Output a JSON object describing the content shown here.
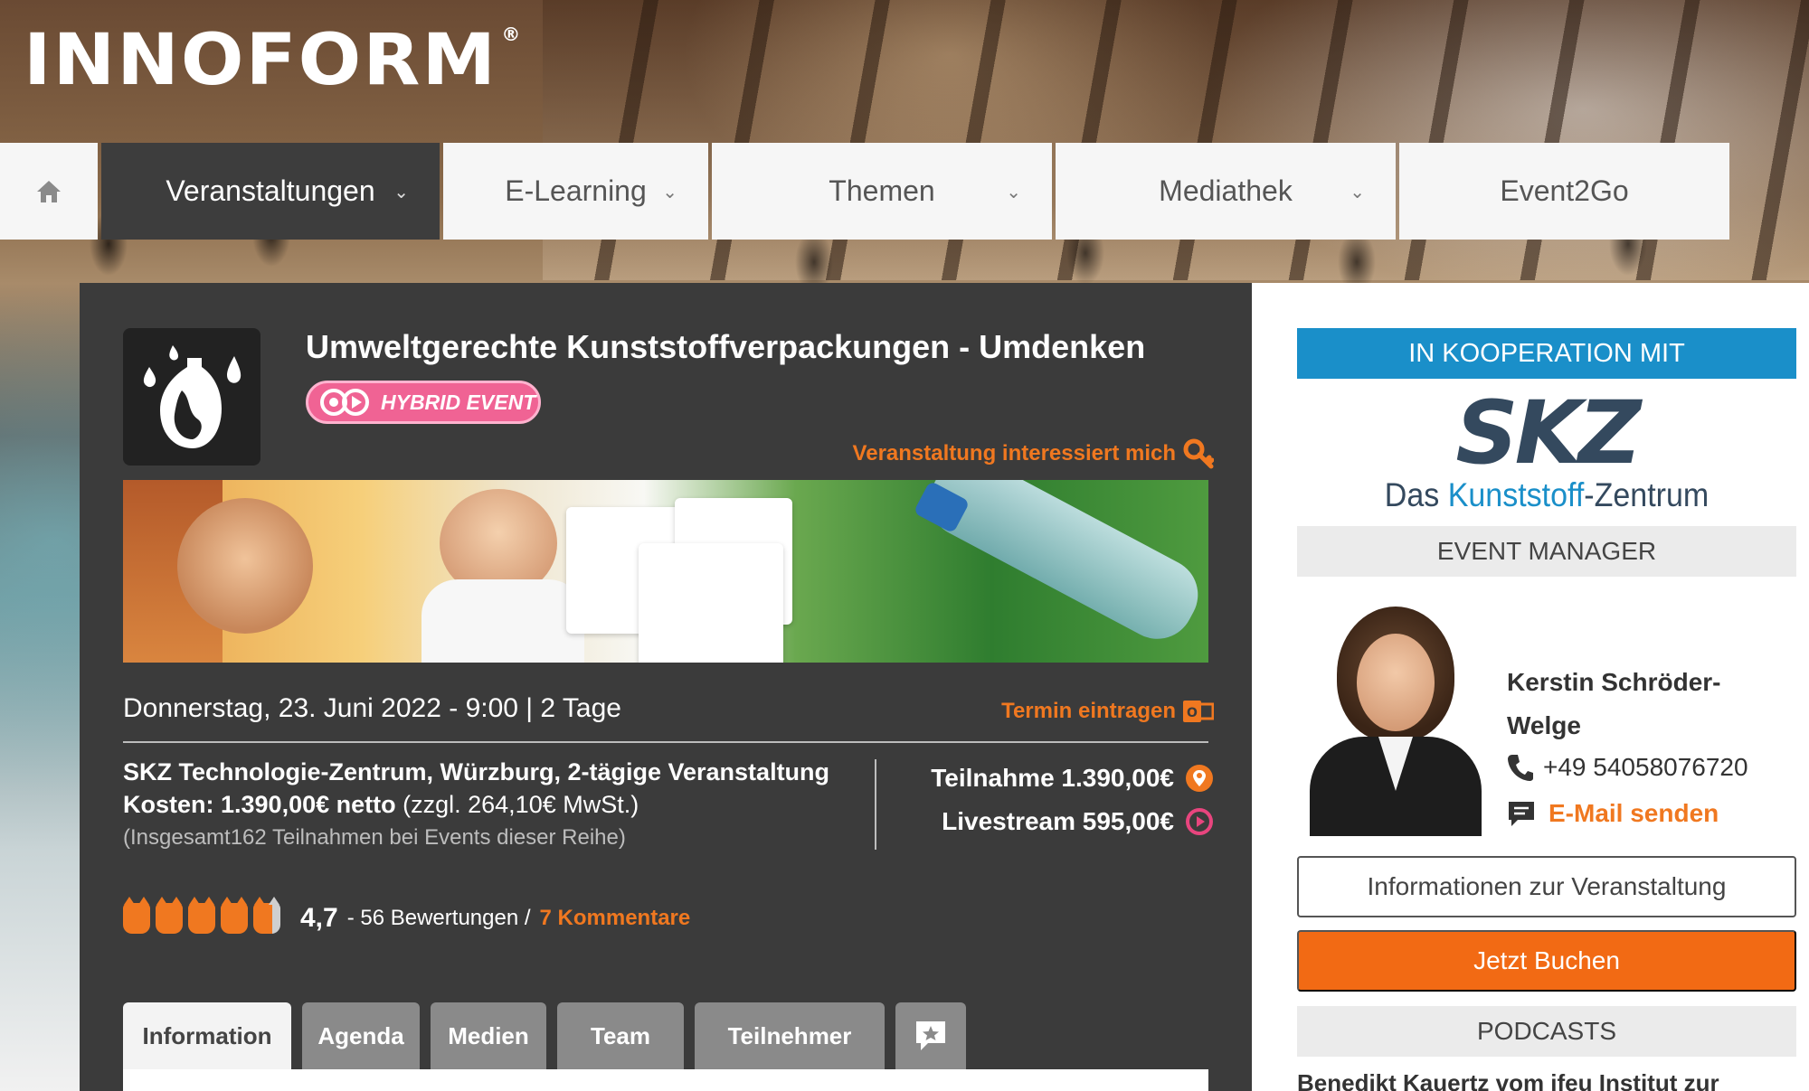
{
  "brand": {
    "logo_text": "INNOFORM",
    "registered": "®"
  },
  "nav": {
    "home_icon": "home-icon",
    "items": [
      {
        "label": "Veranstaltungen",
        "active": true,
        "has_dropdown": true
      },
      {
        "label": "E-Learning",
        "active": false,
        "has_dropdown": true
      },
      {
        "label": "Themen",
        "active": false,
        "has_dropdown": true
      },
      {
        "label": "Mediathek",
        "active": false,
        "has_dropdown": true
      },
      {
        "label": "Event2Go",
        "active": false,
        "has_dropdown": false
      }
    ]
  },
  "event": {
    "title": "Umweltgerechte Kunststoffverpackungen - Umdenken",
    "badge": "HYBRID EVENT",
    "interest_link": "Veranstaltung interessiert mich",
    "date": "Donnerstag, 23. Juni 2022 - 9:00 | 2 Tage",
    "calendar_link": "Termin eintragen",
    "location": "SKZ Technologie-Zentrum, Würzburg, 2-tägige Veranstaltung",
    "cost_label": "Kosten: 1.390,00€ netto",
    "cost_tax": "(zzgl. 264,10€ MwSt.)",
    "total_participations": "(Insgesamt162 Teilnahmen bei Events dieser Reihe)",
    "prices": [
      {
        "label": "Teilnahme 1.390,00€",
        "icon": "location-pin-icon",
        "color": "#f07820"
      },
      {
        "label": "Livestream 595,00€",
        "icon": "play-icon",
        "color": "#e8457e"
      }
    ],
    "rating": {
      "score": "4,7",
      "stars": 4.7,
      "max_stars": 5,
      "reviews": "- 56 Bewertungen /",
      "comments": "7 Kommentare"
    }
  },
  "tabs": [
    {
      "label": "Information",
      "active": true
    },
    {
      "label": "Agenda",
      "active": false
    },
    {
      "label": "Medien",
      "active": false
    },
    {
      "label": "Team",
      "active": false
    },
    {
      "label": "Teilnehmer",
      "active": false
    },
    {
      "label": "",
      "icon": "star-comment-icon",
      "active": false
    }
  ],
  "sidebar": {
    "cooperation_header": "IN KOOPERATION MIT",
    "partner": {
      "logo_letters": "SKZ",
      "logo_sub_prefix": "Das ",
      "logo_sub_highlight": "Kunststoff",
      "logo_sub_suffix": "-Zentrum"
    },
    "event_manager_header": "EVENT MANAGER",
    "manager": {
      "name": "Kerstin Schröder-Welge",
      "phone": "+49 54058076720",
      "email_label": "E-Mail senden"
    },
    "info_button": "Informationen zur Veranstaltung",
    "book_button": "Jetzt Buchen",
    "podcasts_header": "PODCASTS",
    "podcast_teaser": "Benedikt Kauertz vom ifeu Institut zur"
  },
  "colors": {
    "accent_orange": "#f07820",
    "book_orange": "#f26a14",
    "hybrid_pink": "#f06394",
    "coop_blue": "#1a8fc9",
    "panel_dark": "#3b3b3b",
    "nav_active": "#3d3d3d"
  }
}
